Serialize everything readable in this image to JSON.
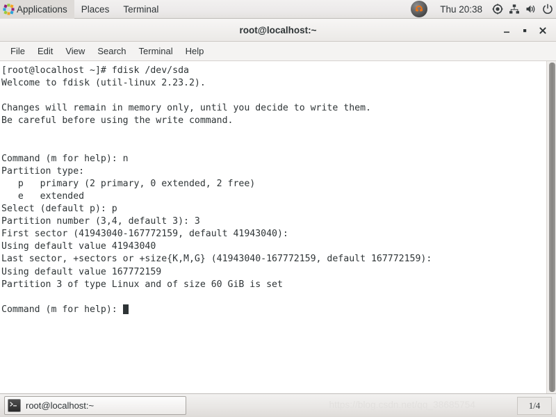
{
  "top_panel": {
    "applications_label": "Applications",
    "places_label": "Places",
    "terminal_label": "Terminal",
    "clock": "Thu 20:38",
    "icons": {
      "apps_menu_icon": "pinwheel-icon",
      "vbox_icon": "virtualbox-guest-icon",
      "accessibility_icon": "accessibility-icon",
      "network_icon": "network-icon",
      "volume_icon": "volume-icon",
      "power_icon": "power-icon"
    }
  },
  "window": {
    "title": "root@localhost:~",
    "minimize_label": "–",
    "maximize_label": "▪",
    "close_label": "✕"
  },
  "menubar": {
    "items": [
      {
        "label": "File"
      },
      {
        "label": "Edit"
      },
      {
        "label": "View"
      },
      {
        "label": "Search"
      },
      {
        "label": "Terminal"
      },
      {
        "label": "Help"
      }
    ]
  },
  "terminal": {
    "lines": [
      "[root@localhost ~]# fdisk /dev/sda",
      "Welcome to fdisk (util-linux 2.23.2).",
      "",
      "Changes will remain in memory only, until you decide to write them.",
      "Be careful before using the write command.",
      "",
      "",
      "Command (m for help): n",
      "Partition type:",
      "   p   primary (2 primary, 0 extended, 2 free)",
      "   e   extended",
      "Select (default p): p",
      "Partition number (3,4, default 3): 3",
      "First sector (41943040-167772159, default 41943040):",
      "Using default value 41943040",
      "Last sector, +sectors or +size{K,M,G} (41943040-167772159, default 167772159):",
      "Using default value 167772159",
      "Partition 3 of type Linux and of size 60 GiB is set",
      "",
      "Command (m for help): "
    ],
    "prompt_text": "Command (m for help): ",
    "cursor": "block-cursor"
  },
  "bottom_panel": {
    "task_label": "root@localhost:~",
    "task_icon": "terminal-icon",
    "watermark": "https://blog.csdn.net/qq_38685754",
    "workspace": "1/4"
  },
  "colors": {
    "panel_bg": "#eceaea",
    "terminal_bg": "#ffffff",
    "terminal_fg": "#2e3436",
    "accent_orange": "#e8731a"
  }
}
